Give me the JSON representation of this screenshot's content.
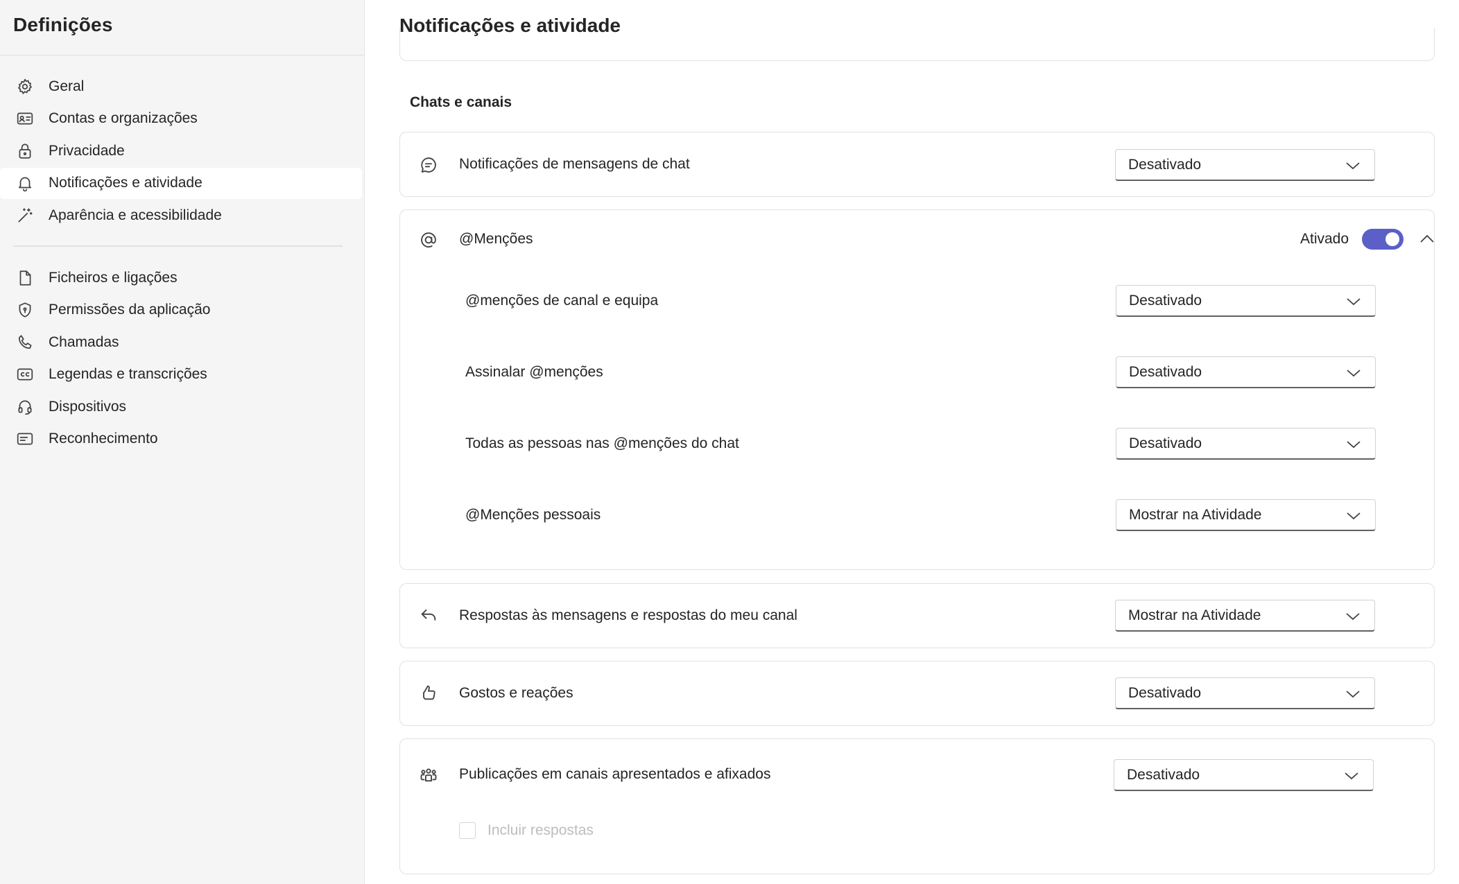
{
  "sidebar": {
    "title": "Definições",
    "items_top": [
      {
        "label": "Geral",
        "icon": "gear-icon"
      },
      {
        "label": "Contas e organizações",
        "icon": "contact-card-icon"
      },
      {
        "label": "Privacidade",
        "icon": "lock-icon"
      },
      {
        "label": "Notificações e atividade",
        "icon": "bell-icon",
        "active": true
      },
      {
        "label": "Aparência e acessibilidade",
        "icon": "magic-wand-icon"
      }
    ],
    "items_bottom": [
      {
        "label": "Ficheiros e ligações",
        "icon": "document-icon"
      },
      {
        "label": "Permissões da aplicação",
        "icon": "shield-icon"
      },
      {
        "label": "Chamadas",
        "icon": "phone-icon"
      },
      {
        "label": "Legendas e transcrições",
        "icon": "closed-caption-icon"
      },
      {
        "label": "Dispositivos",
        "icon": "headset-icon"
      },
      {
        "label": "Reconhecimento",
        "icon": "text-box-icon"
      }
    ]
  },
  "main": {
    "title": "Notificações e atividade",
    "section_title": "Chats e canais",
    "chat_messages": {
      "label": "Notificações de mensagens de chat",
      "value": "Desativado",
      "icon": "chat-bubble-icon"
    },
    "mentions": {
      "label": "@Menções",
      "icon": "at-sign-icon",
      "toggle_label": "Ativado",
      "toggle_on": true,
      "subs": [
        {
          "label": "@menções de canal e equipa",
          "value": "Desativado"
        },
        {
          "label": "Assinalar @menções",
          "value": "Desativado"
        },
        {
          "label": "Todas as pessoas nas @menções do chat",
          "value": "Desativado"
        },
        {
          "label": "@Menções pessoais",
          "value": "Mostrar na Atividade"
        }
      ]
    },
    "replies": {
      "label": "Respostas às mensagens e respostas do meu canal",
      "value": "Mostrar na Atividade",
      "icon": "reply-arrow-icon"
    },
    "likes": {
      "label": "Gostos e reações",
      "value": "Desativado",
      "icon": "thumbs-up-icon"
    },
    "posts": {
      "label": "Publicações em canais apresentados e afixados",
      "value": "Desativado",
      "icon": "people-team-icon",
      "checkbox_label": "Incluir respostas",
      "checkbox_checked": false
    }
  },
  "colors": {
    "accent": "#5b5fc7",
    "sidebar_bg": "#f5f5f5",
    "text": "#242424",
    "disabled_text": "#bdbdbd"
  }
}
